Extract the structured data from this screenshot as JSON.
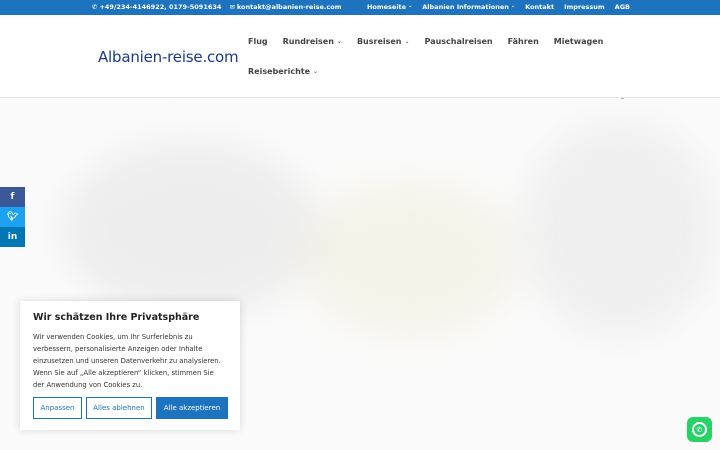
{
  "topbar": {
    "phone": "+49/234-4146922, 0179-5091634",
    "email": "kontakt@albanien-reise.com",
    "nav": [
      {
        "label": "Homeseite",
        "dropdown": true
      },
      {
        "label": "Albanien Informationen",
        "dropdown": true
      },
      {
        "label": "Kontakt",
        "dropdown": false
      },
      {
        "label": "Impressum",
        "dropdown": false
      },
      {
        "label": "AGB",
        "dropdown": false
      }
    ]
  },
  "header": {
    "logo": "Albanien-reise.com",
    "nav_row1": [
      {
        "label": "Flug",
        "dropdown": false
      },
      {
        "label": "Rundreisen",
        "dropdown": true
      },
      {
        "label": "Busreisen",
        "dropdown": true
      },
      {
        "label": "Pauschalreisen",
        "dropdown": false
      },
      {
        "label": "Fähren",
        "dropdown": false
      },
      {
        "label": "Mietwagen",
        "dropdown": false
      }
    ],
    "nav_row2": [
      {
        "label": "Reiseberichte",
        "dropdown": true
      }
    ]
  },
  "social": {
    "facebook": "f",
    "twitter": "t",
    "linkedin": "in"
  },
  "cookie": {
    "title": "Wir schätzen Ihre Privatsphäre",
    "text": "Wir verwenden Cookies, um Ihr Surferlebnis zu verbessern, personalisierte Anzeigen oder Inhalte einzusetzen und unseren Datenverkehr zu analysieren. Wenn Sie auf „Alle akzeptieren“ klicken, stimmen Sie der Anwendung von Cookies zu.",
    "btn_customize": "Anpassen",
    "btn_reject": "Alles ablehnen",
    "btn_accept": "Alle akzeptieren"
  },
  "colors": {
    "accent": "#1e73be",
    "whatsapp": "#25d366"
  }
}
